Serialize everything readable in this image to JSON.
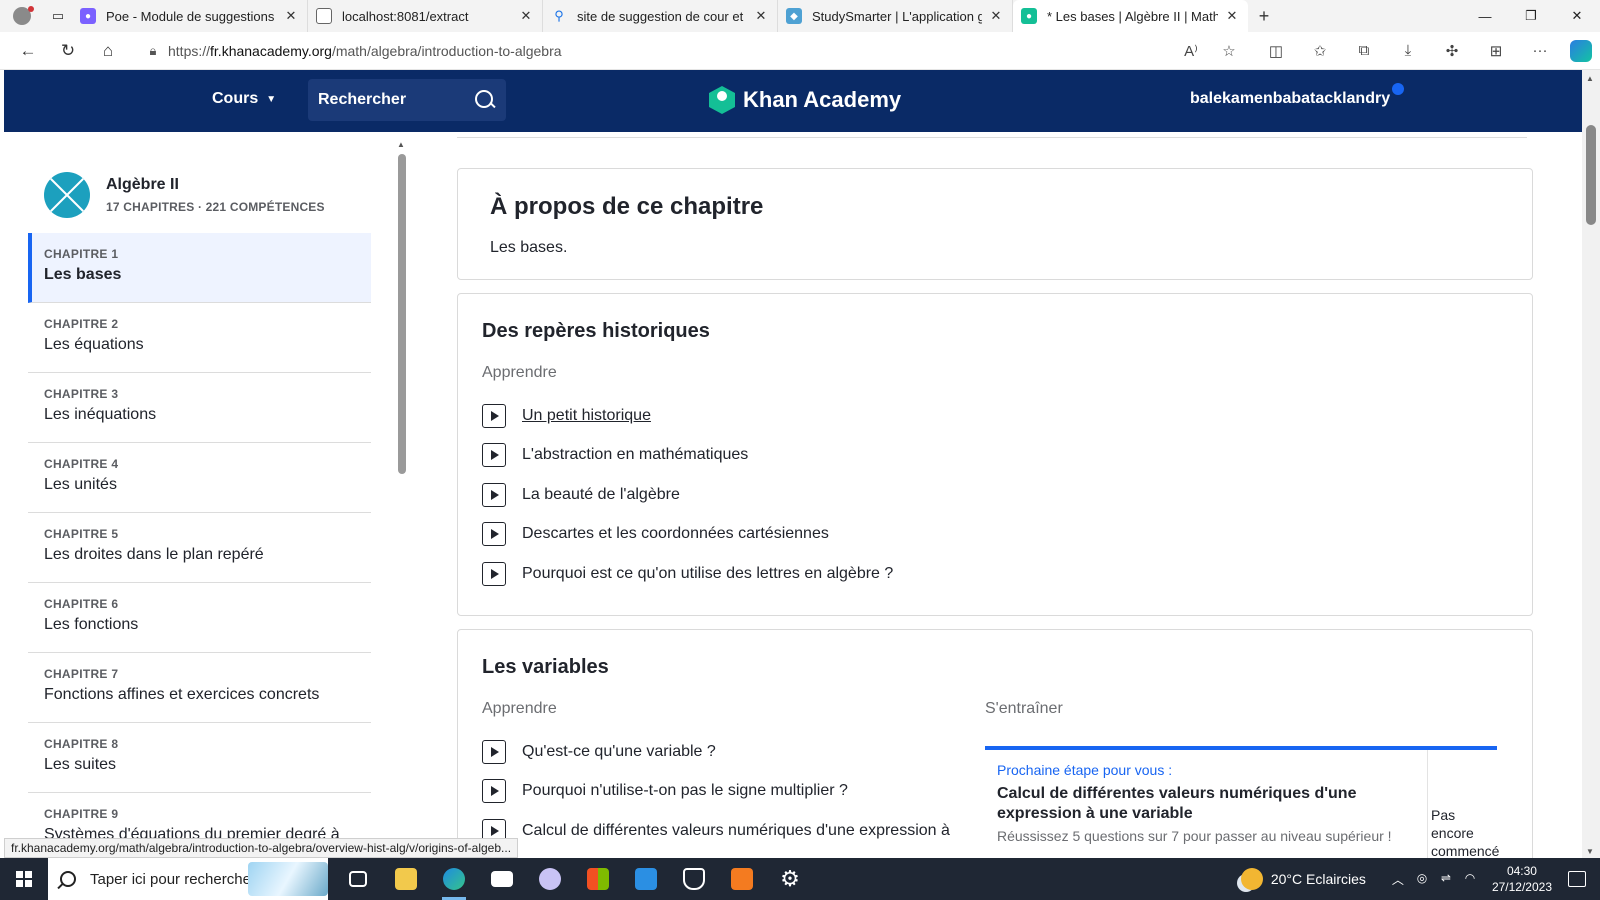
{
  "browser": {
    "tabs": [
      {
        "title": "Poe - Module de suggestions",
        "color": "#7b61ff",
        "icon": "poe-icon"
      },
      {
        "title": "localhost:8081/extract",
        "color": "#888888",
        "icon": "page-icon"
      },
      {
        "title": "site de suggestion de cour et exe",
        "color": "#1a73e8",
        "icon": "search-icon"
      },
      {
        "title": "StudySmarter | L'application grat",
        "color": "#4ea1d3",
        "icon": "studysmarter-icon"
      },
      {
        "title": "* Les bases | Algèbre II | Mathém",
        "color": "#14bf96",
        "icon": "khan-icon"
      }
    ],
    "new_tab": "+",
    "address": {
      "scheme": "https://",
      "host": "fr.khanacademy.org",
      "path": "/math/algebra/introduction-to-algebra"
    }
  },
  "header": {
    "courses_label": "Cours",
    "search_label": "Rechercher",
    "logo_text": "Khan Academy",
    "username": "balekamenbabatacklandry"
  },
  "sidebar": {
    "course_title": "Algèbre II",
    "course_subtitle": "17 CHAPITRES · 221 COMPÉTENCES",
    "chapters": [
      {
        "label": "CHAPITRE 1",
        "name": "Les bases"
      },
      {
        "label": "CHAPITRE 2",
        "name": "Les équations"
      },
      {
        "label": "CHAPITRE 3",
        "name": "Les inéquations"
      },
      {
        "label": "CHAPITRE 4",
        "name": "Les unités"
      },
      {
        "label": "CHAPITRE 5",
        "name": "Les droites dans le plan repéré"
      },
      {
        "label": "CHAPITRE 6",
        "name": "Les fonctions"
      },
      {
        "label": "CHAPITRE 7",
        "name": "Fonctions affines et exercices concrets"
      },
      {
        "label": "CHAPITRE 8",
        "name": "Les suites"
      },
      {
        "label": "CHAPITRE 9",
        "name": "Systèmes d'équations du premier degré à"
      }
    ]
  },
  "main": {
    "about": {
      "title": "À propos de ce chapitre",
      "text": "Les bases."
    },
    "hist": {
      "title": "Des repères historiques",
      "learn_label": "Apprendre",
      "videos": [
        "Un petit historique",
        "L'abstraction en mathématiques",
        "La beauté de l'algèbre",
        "Descartes et les coordonnées cartésiennes",
        "Pourquoi est ce qu'on utilise des lettres en algèbre ?"
      ]
    },
    "vars": {
      "title": "Les variables",
      "learn_label": "Apprendre",
      "practice_label": "S'entraîner",
      "videos": [
        "Qu'est-ce qu'une variable ?",
        "Pourquoi n'utilise-t-on pas le signe multiplier ?",
        "Calcul de différentes valeurs numériques d'une expression à"
      ],
      "next": {
        "label": "Prochaine étape pour vous :",
        "title": "Calcul de différentes valeurs numériques d'une expression à une variable",
        "desc": "Réussissez 5 questions sur 7 pour passer au niveau supérieur !",
        "status": "Pas encore commencé"
      }
    }
  },
  "status_url": "fr.khanacademy.org/math/algebra/introduction-to-algebra/overview-hist-alg/v/origins-of-algeb...",
  "taskbar": {
    "search_placeholder": "Taper ici pour rechercher",
    "weather": "20°C  Eclaircies",
    "time": "04:30",
    "date": "27/12/2023"
  },
  "colors": {
    "ka_navy": "#0a2a66",
    "ka_blue": "#1865f2",
    "ka_green": "#14bf96"
  }
}
